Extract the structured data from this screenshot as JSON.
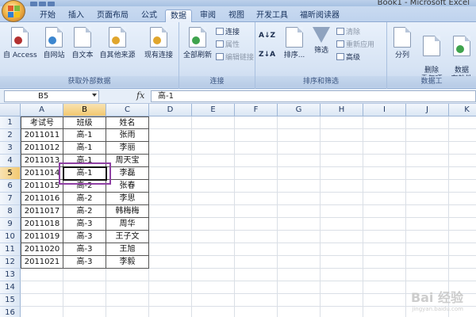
{
  "window": {
    "title": "Book1 - Microsoft Excel"
  },
  "ribbon_tabs": [
    "开始",
    "插入",
    "页面布局",
    "公式",
    "数据",
    "审阅",
    "视图",
    "开发工具",
    "福昕阅读器"
  ],
  "active_tab": "数据",
  "ribbon": {
    "external_data": {
      "label": "获取外部数据",
      "buttons": [
        "自 Access",
        "自网站",
        "自文本",
        "自其他来源",
        "现有连接"
      ]
    },
    "connections": {
      "label": "连接",
      "refresh_all": "全部刷新",
      "small": [
        "连接",
        "属性",
        "编辑链接"
      ]
    },
    "sort_filter": {
      "label": "排序和筛选",
      "sort_label": "排序...",
      "filter_label": "筛选",
      "small": [
        "清除",
        "重新应用",
        "高级"
      ]
    },
    "data_tools": {
      "label": "数据工",
      "split": "分列",
      "remove_dup": "删除\n重复项",
      "validation": "数据\n有效性"
    }
  },
  "formula_bar": {
    "name_box": "B5",
    "fx": "fx",
    "content": "高-1"
  },
  "columns": [
    "A",
    "B",
    "C",
    "D",
    "E",
    "F",
    "G",
    "H",
    "I",
    "J",
    "K"
  ],
  "rows": [
    "1",
    "2",
    "3",
    "4",
    "5",
    "6",
    "7",
    "8",
    "9",
    "10",
    "11",
    "12",
    "13",
    "14",
    "15",
    "16"
  ],
  "selected_col": "B",
  "selected_row": "5",
  "table": [
    [
      "考试号",
      "班级",
      "姓名"
    ],
    [
      "2011011",
      "高-1",
      "张雨"
    ],
    [
      "2011012",
      "高-1",
      "李丽"
    ],
    [
      "2011013",
      "高-1",
      "周天宝"
    ],
    [
      "2011014",
      "高-1",
      "李磊"
    ],
    [
      "2011015",
      "高-2",
      "张春"
    ],
    [
      "2011016",
      "高-2",
      "李思"
    ],
    [
      "2011017",
      "高-2",
      "韩梅梅"
    ],
    [
      "2011018",
      "高-3",
      "周华"
    ],
    [
      "2011019",
      "高-3",
      "王子文"
    ],
    [
      "2011020",
      "高-3",
      "王旭"
    ],
    [
      "2011021",
      "高-3",
      "李毅"
    ]
  ],
  "watermark": {
    "brand": "Bai 经验",
    "url": "jingyan.baidu.com"
  },
  "colors": {
    "annotation": "#8e3fa3",
    "selection_header": "#f2c870"
  }
}
